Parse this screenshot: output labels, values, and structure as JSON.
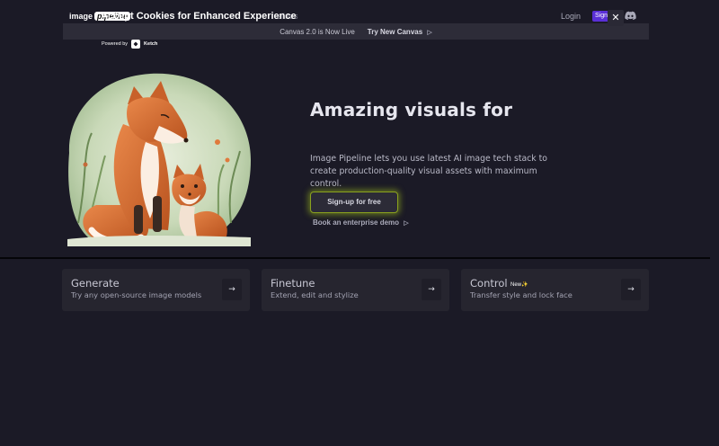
{
  "nav": {
    "logo_word1": "image",
    "logo_word2": "pipeline",
    "ghost_link": "elines",
    "login": "Login",
    "sign": "Sign"
  },
  "cookie": {
    "title": "Accept Cookies for Enhanced Experience",
    "close": "✕",
    "powered_by": "Powered by",
    "brand": "Ketch"
  },
  "announcement": {
    "text": "Canvas 2.0 is Now Live",
    "link": "Try New Canvas",
    "arrow": "▷"
  },
  "hero": {
    "title": "Amazing visuals for",
    "description": "Image Pipeline lets you use latest AI image tech stack to create production-quality visual assets with maximum control.",
    "signup": "Sign-up for free",
    "enterprise": "Book an enterprise demo",
    "enterprise_arrow": "▷"
  },
  "cards": [
    {
      "title": "Generate",
      "subtitle": "Try any open-source image models",
      "badge": "",
      "arrow": "→"
    },
    {
      "title": "Finetune",
      "subtitle": "Extend, edit and stylize",
      "badge": "",
      "arrow": "→"
    },
    {
      "title": "Control",
      "subtitle": "Transfer style and lock face",
      "badge": "New",
      "badge_icon": "✨",
      "arrow": "→"
    }
  ],
  "colors": {
    "background": "#1b1a26",
    "accent_purple": "#5a2fd6",
    "glow_green": "#8aa21e"
  },
  "icons": [
    "discord-icon",
    "close-icon",
    "ketch-icon",
    "arrow-right-icon",
    "play-icon",
    "sparkle-icon"
  ]
}
